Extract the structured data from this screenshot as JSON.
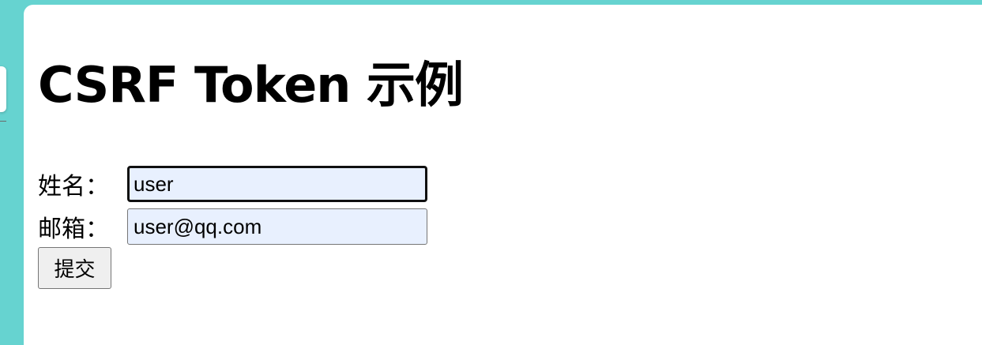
{
  "page": {
    "title": "CSRF Token 示例"
  },
  "form": {
    "name_label": "姓名：",
    "name_value": "user",
    "email_label": "邮箱：",
    "email_value": "user@qq.com",
    "submit_label": "提交"
  },
  "colors": {
    "background": "#66d3d0",
    "input_autofill": "#e8f0fe",
    "button": "#efefef"
  }
}
